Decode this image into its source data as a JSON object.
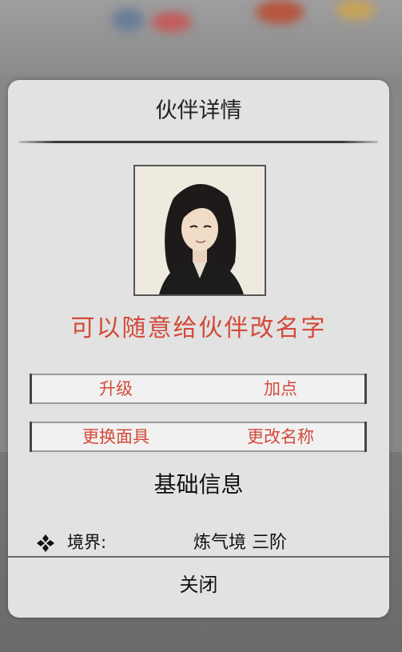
{
  "dialog": {
    "title": "伙伴详情",
    "rename_tip": "可以随意给伙伴改名字",
    "buttons": {
      "upgrade": "升级",
      "add_points": "加点",
      "change_mask": "更换面具",
      "rename": "更改名称"
    },
    "section_title": "基础信息",
    "realm": {
      "label": "境界:",
      "value": "炼气境 三阶"
    },
    "close": "关闭"
  },
  "colors": {
    "accent_red": "#d34a3a",
    "panel_bg": "#e2e2e2"
  }
}
